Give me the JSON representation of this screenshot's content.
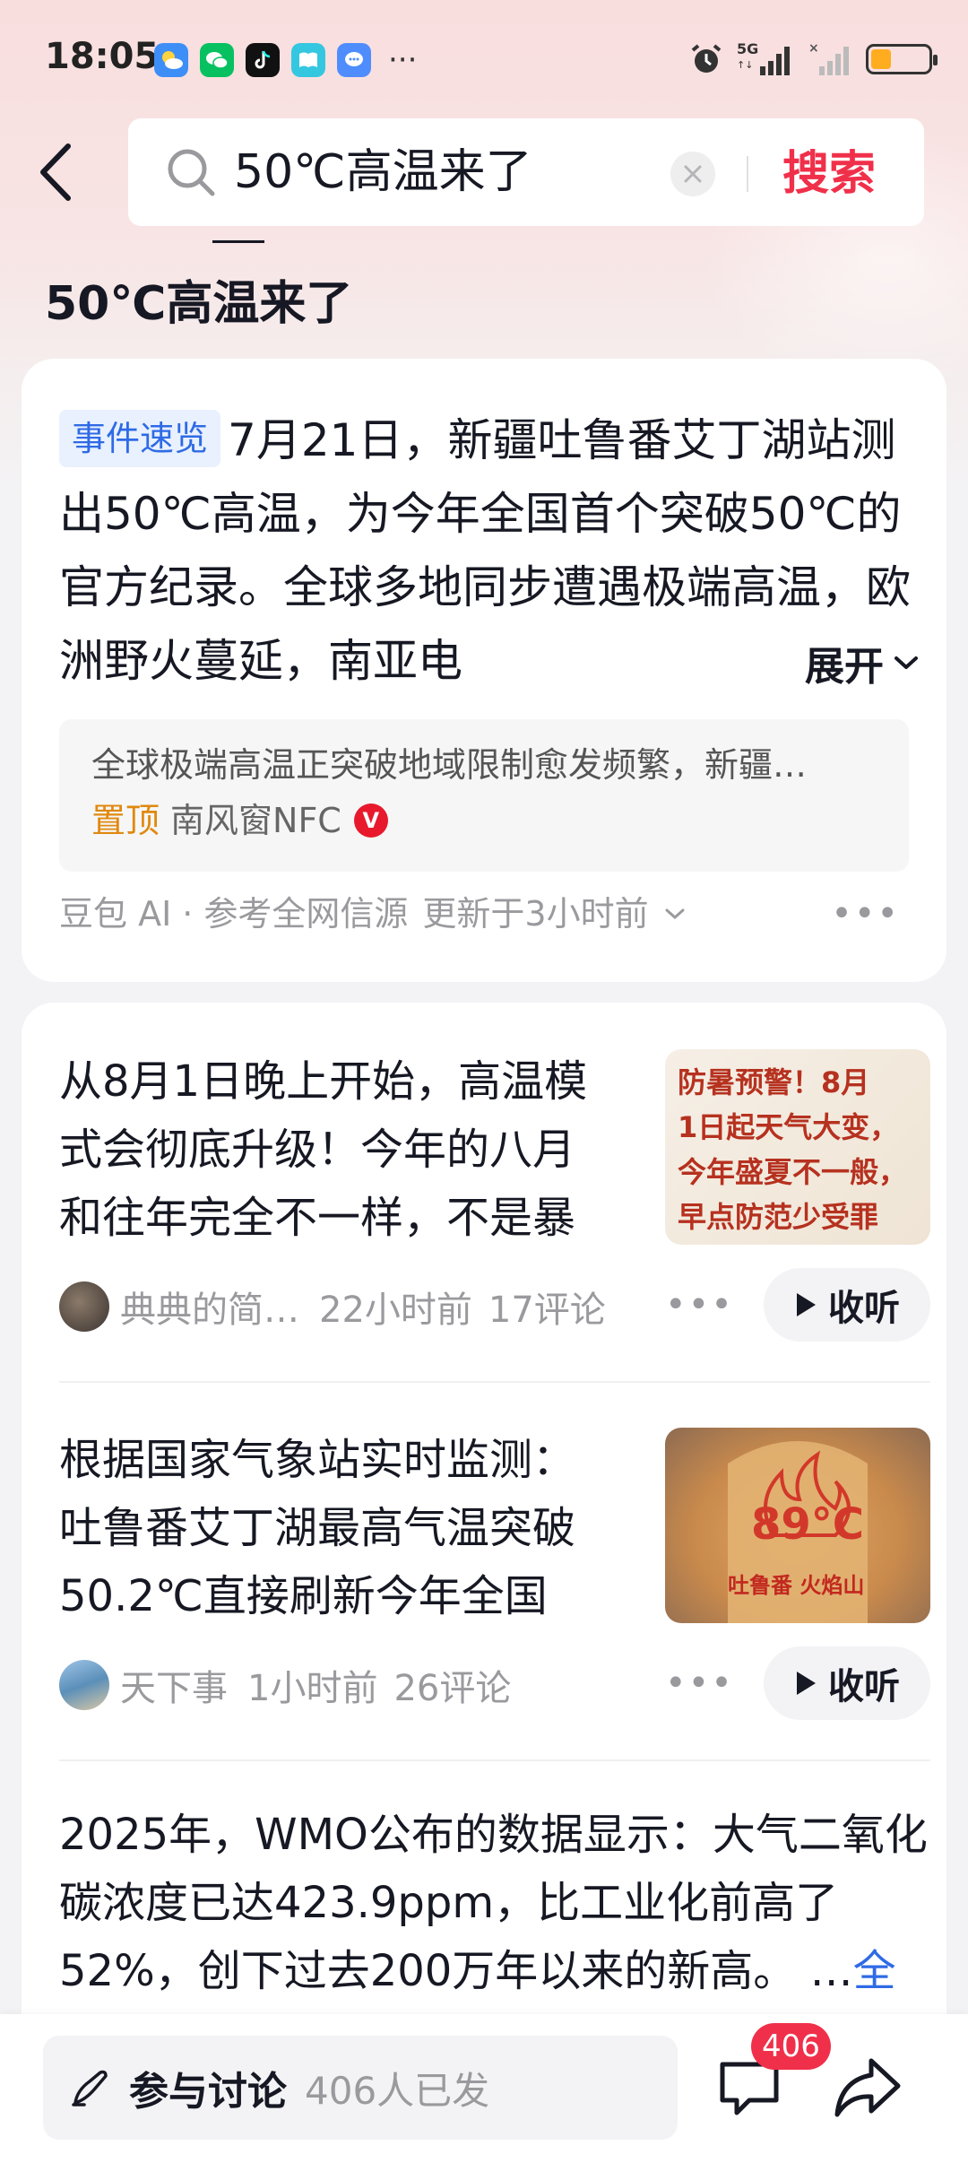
{
  "status_bar": {
    "time": "18:05",
    "network": "5G",
    "battery_level_pct": 35,
    "battery_color": "#ffad1f"
  },
  "search": {
    "query": "50℃高温来了",
    "submit_label": "搜索"
  },
  "page_title": "50℃高温来了",
  "summary": {
    "tag": "事件速览",
    "text": "7月21日，新疆吐鲁番艾丁湖站测出50℃高温，为今年全国首个突破50℃的官方纪录。全球多地同步遭遇极端高温，欧洲野火蔓延，南亚电",
    "expand_label": "展开",
    "source_snippet": "全球极端高温正突破地域限制愈发频繁，新疆…",
    "pin_label": "置顶",
    "source_author": "南风窗NFC",
    "verify_badge": "V",
    "footer_ai": "豆包 AI",
    "footer_ref": "参考全网信源",
    "footer_update": "更新于3小时前"
  },
  "feed": [
    {
      "text": "从8月1日晚上开始，高温模式会彻底升级！今年的八月和往年完全不一样，不是暴晒…",
      "thumb_lines": [
        "防暑预警！8月",
        "1日起天气大变，",
        "今年盛夏不一般，",
        "早点防范少受罪"
      ],
      "author": "典典的简…",
      "time": "22小时前",
      "comments": "17评论",
      "listen_label": "收听"
    },
    {
      "text": "根据国家气象站实时监测：吐鲁番艾丁湖最高气温突破50.2℃直接刷新今年全国最…",
      "thumb_lines": [
        "89°C",
        "吐鲁番 火焰山"
      ],
      "author": "天下事",
      "time": "1小时前",
      "comments": "26评论",
      "listen_label": "收听"
    }
  ],
  "long_post": {
    "text": "2025年，WMO公布的数据显示：大气二氧化碳浓度已达423.9ppm，比工业化前高了52%，创下过去200万年以来的新高。 …",
    "link_label": "全文"
  },
  "bottom_bar": {
    "discuss_label": "参与讨论",
    "discuss_count": "406人已发",
    "comment_badge": "406"
  },
  "colors": {
    "accent_red": "#f0304a",
    "link_blue": "#2f6ae6",
    "pin_orange": "#e0890f"
  }
}
